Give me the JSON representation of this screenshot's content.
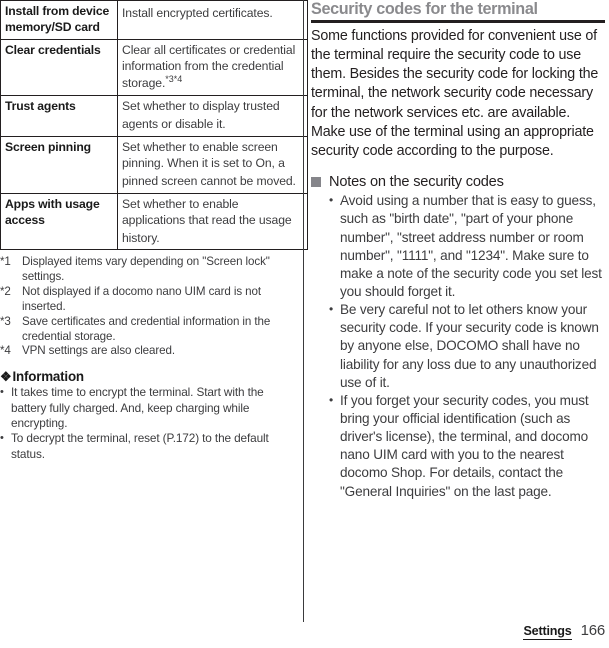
{
  "left_column": {
    "table": {
      "rows": [
        {
          "name": "Install from device memory/SD card",
          "description": "Install encrypted certificates.",
          "note_marks": ""
        },
        {
          "name": "Clear credentials",
          "description": "Clear all certificates or credential information from the credential storage.",
          "note_marks": "*3*4"
        },
        {
          "name": "Trust agents",
          "description": "Set whether to display trusted agents or disable it.",
          "note_marks": ""
        },
        {
          "name": "Screen pinning",
          "description": "Set whether to enable screen pinning. When it is set to On, a pinned screen cannot be moved.",
          "note_marks": ""
        },
        {
          "name": "Apps with usage access",
          "description": "Set whether to enable applications that read the usage history.",
          "note_marks": ""
        }
      ]
    },
    "footnotes": [
      {
        "mark": "*1",
        "text": "Displayed items vary depending on \"Screen lock\" settings."
      },
      {
        "mark": "*2",
        "text": "Not displayed if a docomo nano UIM card is not inserted."
      },
      {
        "mark": "*3",
        "text": "Save certificates and credential information in the credential storage."
      },
      {
        "mark": "*4",
        "text": "VPN settings are also cleared."
      }
    ],
    "information": {
      "marker": "❖",
      "heading": "Information",
      "items": [
        "It takes time to encrypt the terminal. Start with the battery fully charged. And, keep charging while encrypting.",
        "To decrypt the terminal, reset (P.172) to the default status."
      ]
    }
  },
  "right_column": {
    "section_title": "Security codes for the terminal",
    "intro": "Some functions provided for convenient use of the terminal require the security code to use them. Besides the security code for locking the terminal, the network security code necessary for the network services etc. are available. Make use of the terminal using an appropriate security code according to the purpose.",
    "subsection": {
      "marker": "square-marker",
      "heading": "Notes on the security codes",
      "items": [
        "Avoid using a number that is easy to guess, such as \"birth date\", \"part of your phone number\", \"street address number or room number\", \"1111\", and \"1234\". Make sure to make a note of the security code you set lest you should forget it.",
        "Be very careful not to let others know your security code. If your security code is known by anyone else, DOCOMO shall have no liability for any loss due to any unauthorized use of it.",
        "If you forget your security codes, you must bring your official identification (such as driver's license), the terminal, and docomo nano UIM card with you to the nearest docomo Shop. For details, contact the \"General Inquiries\" on the last page."
      ]
    }
  },
  "footer": {
    "chapter": "Settings",
    "page_number": "166"
  },
  "bullets": {
    "dot": "•"
  },
  "colors": {
    "text": "#231f20",
    "muted_text": "#3d3d3f",
    "title_gray": "#8a8a8d",
    "marker_gray": "#85858a",
    "rule": "#231f20"
  }
}
